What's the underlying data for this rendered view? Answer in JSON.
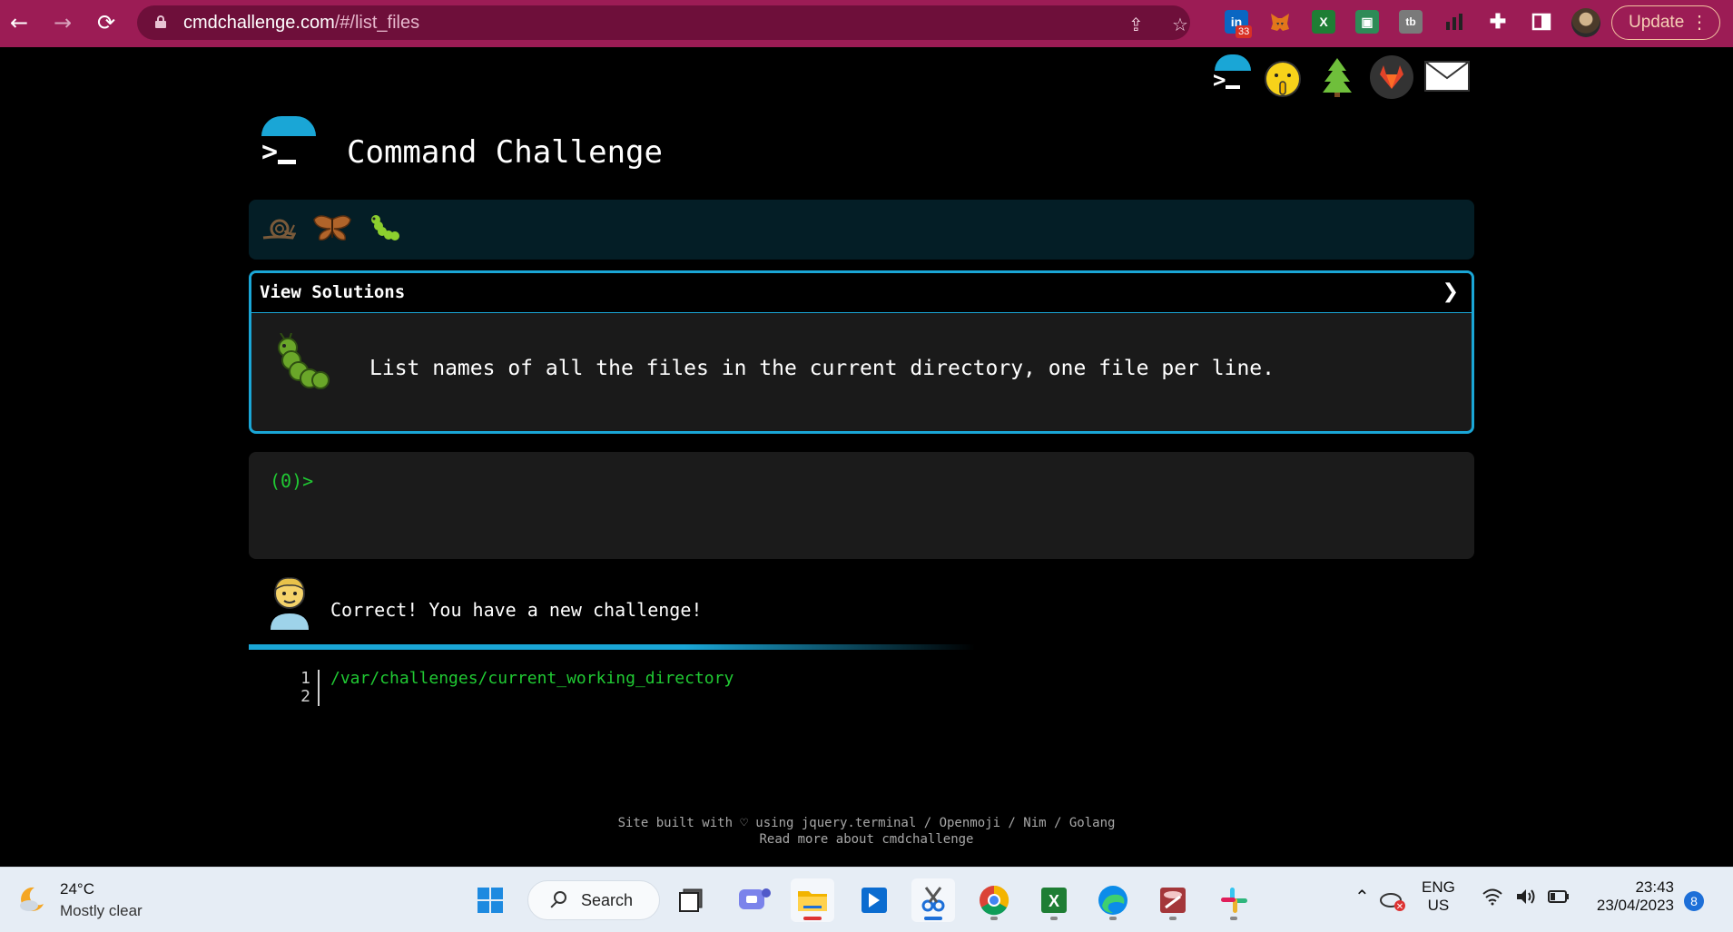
{
  "browser": {
    "url_domain": "cmdchallenge.com",
    "url_path": "/#/list_files",
    "extension_badge": "33",
    "update_label": "Update"
  },
  "page": {
    "brand_title": "Command Challenge",
    "challenge_header": "View Solutions",
    "challenge_text": "List names of all the files in the current directory, one file per line.",
    "prompt": "(0)>",
    "feedback": "Correct! You have a new challenge!",
    "output_lines": [
      {
        "num": "1",
        "text": "/var/challenges/current_working_directory"
      },
      {
        "num": "2",
        "text": ""
      }
    ],
    "footer_line1": "Site built with ♡ using jquery.terminal / Openmoji / Nim / Golang",
    "footer_line2": "Read more about cmdchallenge"
  },
  "taskbar": {
    "temperature": "24°C",
    "weather": "Mostly clear",
    "search_label": "Search",
    "language": "ENG",
    "region": "US",
    "time": "23:43",
    "date": "23/04/2023",
    "notifications": "8"
  },
  "colors": {
    "chrome": "#9c1c55",
    "accent": "#1aa6d6",
    "prompt_green": "#20c933"
  }
}
